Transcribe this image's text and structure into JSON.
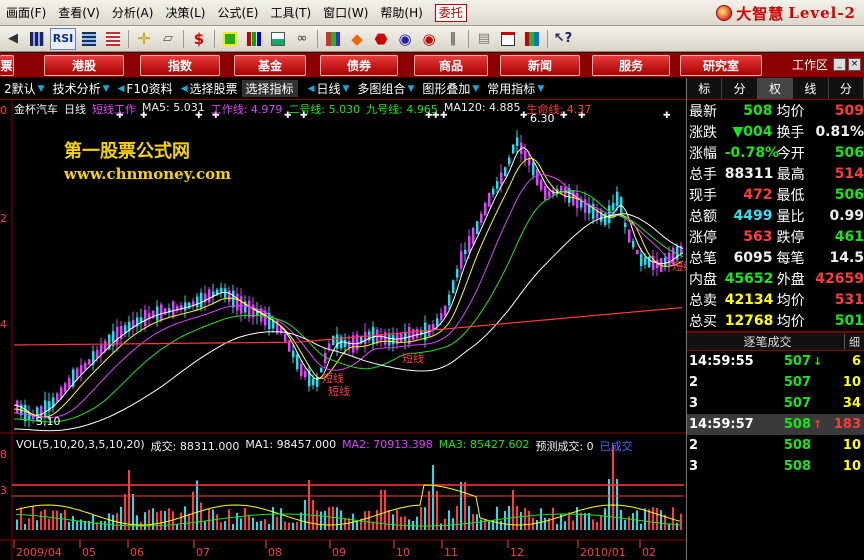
{
  "menu": {
    "items": [
      "画面(F)",
      "查看(V)",
      "分析(A)",
      "决策(L)",
      "公式(E)",
      "工具(T)",
      "窗口(W)",
      "帮助(H)"
    ],
    "entrust": "委托",
    "brand_cn": "大智慧",
    "brand_en": "Level-2"
  },
  "nav": {
    "left": "票",
    "buttons": [
      "港股",
      "指数",
      "基金",
      "债券",
      "商品",
      "新闻",
      "服务",
      "研究室"
    ],
    "workzone": "工作区"
  },
  "chart_toolbar": {
    "items": [
      "2默认",
      "技术分析",
      "F10资料",
      "选择股票",
      "选择指标",
      "日线",
      "多图组合",
      "图形叠加",
      "常用指标"
    ]
  },
  "legend": {
    "stock": "金杯汽车",
    "period": "日线",
    "short_line_name": "短线工作",
    "ma5": "MA5: 5.031",
    "work": "工作线: 4.979",
    "line2": "二号线: 5.030",
    "nine": "九号线: 4.965",
    "ma120": "MA120: 4.885",
    "life": "生命线: 4.37"
  },
  "watermark": {
    "line1": "第一股票公式网",
    "line2": "www.chnmoney.com"
  },
  "price_labels": {
    "high": "6.30",
    "low": "3.10",
    "short1": "短线",
    "short2": "短线",
    "short3": "短线",
    "short4": "短线"
  },
  "vol_legend": {
    "name": "VOL(5,10,20,3,5,10,20)",
    "vol": "成交: 88311.000",
    "ma1": "MA1: 98457.000",
    "ma2": "MA2: 70913.398",
    "ma3": "MA3: 85427.602",
    "forecast": "预测成交: 0",
    "done": "已成交"
  },
  "axis": {
    "y_left": [
      "0",
      "2",
      "4",
      "8",
      "3"
    ],
    "x_labels": [
      "2009/04",
      "05",
      "06",
      "07",
      "08",
      "09",
      "10",
      "11",
      "12",
      "2010/01",
      "02"
    ]
  },
  "right_tabs": [
    "标",
    "分",
    "权",
    "线",
    "分"
  ],
  "quote": [
    {
      "l1": "最新",
      "v1": "508",
      "c1": "green",
      "l2": "均价",
      "v2": "509",
      "c2": "red"
    },
    {
      "l1": "涨跌",
      "v1": "▼004",
      "c1": "green",
      "l2": "换手",
      "v2": "0.81%",
      "c2": "white"
    },
    {
      "l1": "涨幅",
      "v1": "-0.78%",
      "c1": "green",
      "l2": "今开",
      "v2": "506",
      "c2": "green"
    },
    {
      "l1": "总手",
      "v1": "88311",
      "c1": "white",
      "l2": "最高",
      "v2": "514",
      "c2": "red"
    },
    {
      "l1": "现手",
      "v1": "472",
      "c1": "red",
      "l2": "最低",
      "v2": "506",
      "c2": "green"
    },
    {
      "l1": "总额",
      "v1": "4499",
      "c1": "cyan",
      "l2": "量比",
      "v2": "0.99",
      "c2": "white"
    },
    {
      "l1": "涨停",
      "v1": "563",
      "c1": "red",
      "l2": "跌停",
      "v2": "461",
      "c2": "green"
    },
    {
      "l1": "总笔",
      "v1": "6095",
      "c1": "white",
      "l2": "每笔",
      "v2": "14.5",
      "c2": "white"
    },
    {
      "l1": "内盘",
      "v1": "45652",
      "c1": "green",
      "l2": "外盘",
      "v2": "42659",
      "c2": "red"
    },
    {
      "l1": "总卖",
      "v1": "42134",
      "c1": "yellow",
      "l2": "均价",
      "v2": "531",
      "c2": "red"
    },
    {
      "l1": "总买",
      "v1": "12768",
      "c1": "yellow",
      "l2": "均价",
      "v2": "501",
      "c2": "green"
    }
  ],
  "ticks_header": {
    "title": "逐笔成交",
    "btn": "细"
  },
  "ticks": [
    {
      "t": "14:59:55",
      "p": "507",
      "pc": "green",
      "a": "↓",
      "ac": "green",
      "v": "6",
      "vc": "yellow",
      "hl": false
    },
    {
      "t": "2",
      "p": "507",
      "pc": "green",
      "a": "",
      "ac": "",
      "v": "10",
      "vc": "yellow",
      "hl": false
    },
    {
      "t": "3",
      "p": "507",
      "pc": "green",
      "a": "",
      "ac": "",
      "v": "34",
      "vc": "yellow",
      "hl": false
    },
    {
      "t": "14:59:57",
      "p": "508",
      "pc": "green",
      "a": "↑",
      "ac": "red",
      "v": "183",
      "vc": "red",
      "hl": true
    },
    {
      "t": "2",
      "p": "508",
      "pc": "green",
      "a": "",
      "ac": "",
      "v": "10",
      "vc": "yellow",
      "hl": false
    },
    {
      "t": "3",
      "p": "508",
      "pc": "green",
      "a": "",
      "ac": "",
      "v": "10",
      "vc": "yellow",
      "hl": false
    }
  ],
  "colors": {
    "up": "#ff3b3b",
    "down": "#19e619",
    "purple": "#e040ff",
    "cyan": "#22ddee",
    "yellow": "#ffff00",
    "brand": "#d40000"
  }
}
